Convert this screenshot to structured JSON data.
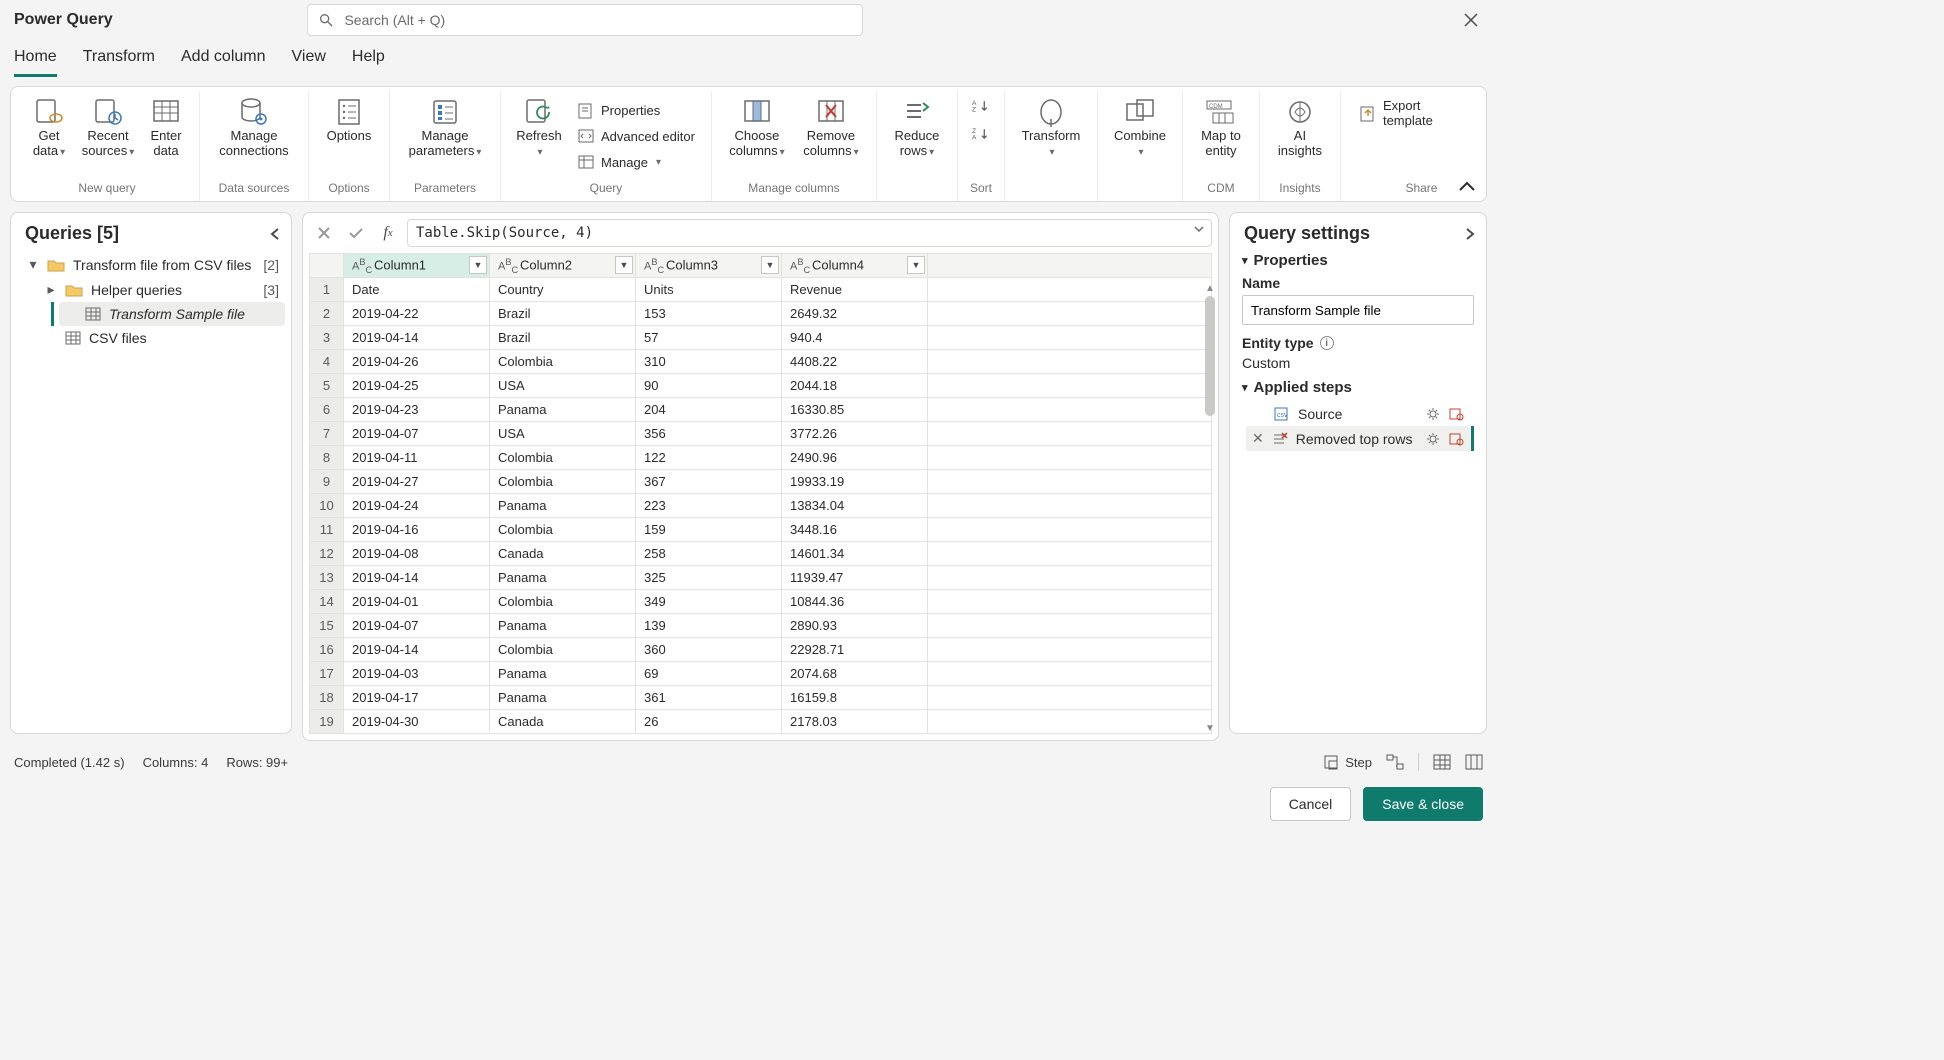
{
  "app_title": "Power Query",
  "search_placeholder": "Search (Alt + Q)",
  "tabs": [
    "Home",
    "Transform",
    "Add column",
    "View",
    "Help"
  ],
  "ribbon": {
    "get_data": "Get data",
    "recent_sources": "Recent sources",
    "enter_data": "Enter data",
    "group_new_query": "New query",
    "manage_connections": "Manage connections",
    "group_data_sources": "Data sources",
    "options": "Options",
    "group_options": "Options",
    "manage_parameters": "Manage parameters",
    "group_parameters": "Parameters",
    "refresh": "Refresh",
    "properties": "Properties",
    "advanced_editor": "Advanced editor",
    "manage": "Manage",
    "group_query": "Query",
    "choose_columns": "Choose columns",
    "remove_columns": "Remove columns",
    "group_manage_columns": "Manage columns",
    "reduce_rows": "Reduce rows",
    "group_sort": "Sort",
    "transform": "Transform",
    "combine": "Combine",
    "map_to_entity": "Map to entity",
    "group_cdm": "CDM",
    "ai_insights": "AI insights",
    "group_insights": "Insights",
    "export_template": "Export template",
    "group_share": "Share"
  },
  "queries": {
    "title": "Queries [5]",
    "items": [
      {
        "label": "Transform file from CSV files",
        "count": "[2]",
        "kind": "folder",
        "expanded": true
      },
      {
        "label": "Helper queries",
        "count": "[3]",
        "kind": "folder",
        "expanded": false,
        "indent": 1
      },
      {
        "label": "Transform Sample file",
        "kind": "table",
        "indent": 2,
        "selected": true,
        "italic": true
      },
      {
        "label": "CSV files",
        "kind": "table",
        "indent": 1
      }
    ]
  },
  "formula": "Table.Skip(Source, 4)",
  "columns": [
    "Column1",
    "Column2",
    "Column3",
    "Column4"
  ],
  "rows": [
    [
      "Date",
      "Country",
      "Units",
      "Revenue"
    ],
    [
      "2019-04-22",
      "Brazil",
      "153",
      "2649.32"
    ],
    [
      "2019-04-14",
      "Brazil",
      "57",
      "940.4"
    ],
    [
      "2019-04-26",
      "Colombia",
      "310",
      "4408.22"
    ],
    [
      "2019-04-25",
      "USA",
      "90",
      "2044.18"
    ],
    [
      "2019-04-23",
      "Panama",
      "204",
      "16330.85"
    ],
    [
      "2019-04-07",
      "USA",
      "356",
      "3772.26"
    ],
    [
      "2019-04-11",
      "Colombia",
      "122",
      "2490.96"
    ],
    [
      "2019-04-27",
      "Colombia",
      "367",
      "19933.19"
    ],
    [
      "2019-04-24",
      "Panama",
      "223",
      "13834.04"
    ],
    [
      "2019-04-16",
      "Colombia",
      "159",
      "3448.16"
    ],
    [
      "2019-04-08",
      "Canada",
      "258",
      "14601.34"
    ],
    [
      "2019-04-14",
      "Panama",
      "325",
      "11939.47"
    ],
    [
      "2019-04-01",
      "Colombia",
      "349",
      "10844.36"
    ],
    [
      "2019-04-07",
      "Panama",
      "139",
      "2890.93"
    ],
    [
      "2019-04-14",
      "Colombia",
      "360",
      "22928.71"
    ],
    [
      "2019-04-03",
      "Panama",
      "69",
      "2074.68"
    ],
    [
      "2019-04-17",
      "Panama",
      "361",
      "16159.8"
    ],
    [
      "2019-04-30",
      "Canada",
      "26",
      "2178.03"
    ]
  ],
  "settings": {
    "title": "Query settings",
    "properties": "Properties",
    "name_label": "Name",
    "name_value": "Transform Sample file",
    "entity_type_label": "Entity type",
    "entity_type_value": "Custom",
    "applied_steps": "Applied steps",
    "steps": [
      {
        "name": "Source",
        "sel": false
      },
      {
        "name": "Removed top rows",
        "sel": true
      }
    ]
  },
  "status": {
    "completed": "Completed (1.42 s)",
    "columns": "Columns: 4",
    "rows": "Rows: 99+",
    "step": "Step"
  },
  "footer": {
    "cancel": "Cancel",
    "save": "Save & close"
  }
}
